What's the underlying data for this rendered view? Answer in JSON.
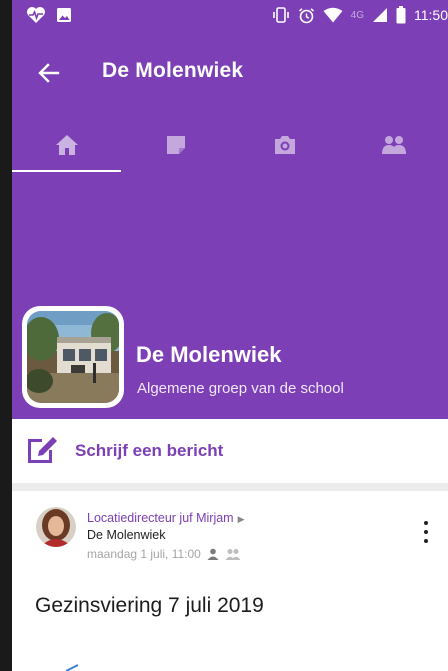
{
  "colors": {
    "primary": "#7c3fb5",
    "header_text": "#ffffff",
    "accent_text": "#7c3fb5",
    "muted": "#a5a5a5"
  },
  "status_bar": {
    "left_icons": [
      "heartbeat-icon",
      "image-icon"
    ],
    "right_icons": [
      "vibrate-icon",
      "alarm-icon",
      "wifi-icon",
      "signal-icon",
      "battery-icon"
    ],
    "network_label": "4G",
    "time": "11:50"
  },
  "toolbar": {
    "back_icon": "arrow-left-icon",
    "title": "De Molenwiek"
  },
  "tabs": [
    {
      "icon": "home-icon",
      "active": true
    },
    {
      "icon": "note-icon",
      "active": false
    },
    {
      "icon": "camera-icon",
      "active": false
    },
    {
      "icon": "group-icon",
      "active": false
    }
  ],
  "group": {
    "name": "De Molenwiek",
    "subtitle": "Algemene groep van de school"
  },
  "write_message": {
    "icon": "edit-icon",
    "label": "Schrijf een bericht"
  },
  "post": {
    "author": "Locatiedirecteur juf Mirjam",
    "author_arrow": "▶",
    "group": "De Molenwiek",
    "date": "maandag 1 juli, 11:00",
    "visibility_icons": [
      "person-icon",
      "group-icon"
    ],
    "title": "Gezinsviering 7 juli 2019",
    "menu_icon": "more-vertical-icon"
  }
}
